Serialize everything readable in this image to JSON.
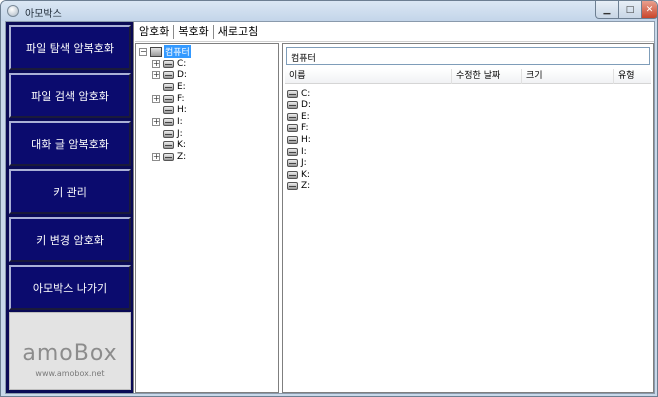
{
  "window": {
    "title": "아모박스"
  },
  "sidebar": {
    "buttons": [
      {
        "label": "파일 탐색 암복호화"
      },
      {
        "label": "파일 검색 암호화"
      },
      {
        "label": "대화 글 암복호화"
      },
      {
        "label": "키 관리"
      },
      {
        "label": "키 변경 암호화"
      },
      {
        "label": "아모박스 나가기"
      }
    ],
    "logo": {
      "text": "amoBox",
      "url_text": "www.amobox.net"
    }
  },
  "toolbar": {
    "items": [
      "암호화",
      "복호화",
      "새로고침"
    ]
  },
  "tree": {
    "root_label": "컴퓨터",
    "drives": [
      {
        "label": "C:",
        "expandable": true
      },
      {
        "label": "D:",
        "expandable": true
      },
      {
        "label": "E:",
        "expandable": false
      },
      {
        "label": "F:",
        "expandable": true
      },
      {
        "label": "H:",
        "expandable": false
      },
      {
        "label": "I:",
        "expandable": true
      },
      {
        "label": "J:",
        "expandable": false
      },
      {
        "label": "K:",
        "expandable": false
      },
      {
        "label": "Z:",
        "expandable": true
      }
    ]
  },
  "path": {
    "value": "컴퓨터"
  },
  "list": {
    "columns": [
      "이름",
      "수정한 날짜",
      "크기",
      "유형"
    ],
    "rows": [
      "C:",
      "D:",
      "E:",
      "F:",
      "H:",
      "I:",
      "J:",
      "K:",
      "Z:"
    ]
  },
  "icons": {
    "drive": "drive-icon",
    "computer": "computer-icon",
    "app": "app-icon"
  }
}
